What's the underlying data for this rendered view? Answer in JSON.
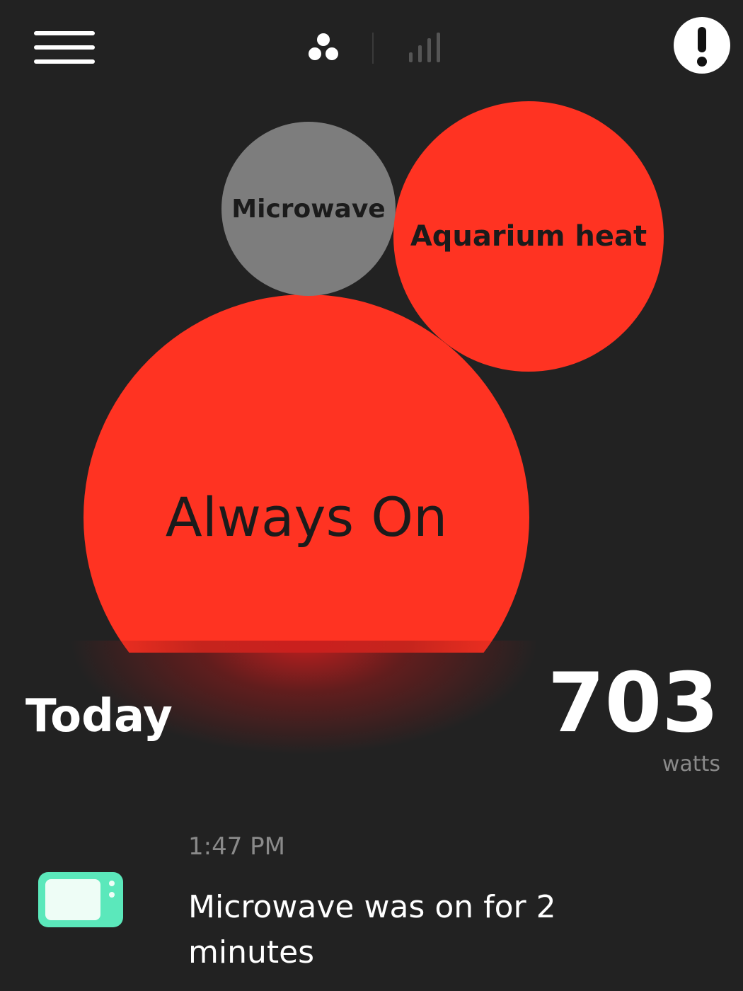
{
  "header": {
    "menu_icon": "hamburger-menu-icon",
    "views": [
      {
        "icon": "bubbles-view-icon",
        "active": true
      },
      {
        "icon": "bar-chart-view-icon",
        "active": false
      }
    ],
    "alert_icon": "exclamation-alert-icon"
  },
  "bubbles": [
    {
      "label": "Microwave",
      "color": "#7d7d7d"
    },
    {
      "label": "Aquarium heat",
      "color": "#ff3322"
    },
    {
      "label": "Always On",
      "color": "#ff3322"
    }
  ],
  "summary": {
    "period": "Today",
    "value": "703",
    "unit": "watts"
  },
  "feed": {
    "time": "1:47 PM",
    "icon": "microwave-icon",
    "icon_color": "#5be8bb",
    "message": "Microwave was on for 2 minutes"
  },
  "colors": {
    "background": "#222222",
    "accent": "#ff3322"
  }
}
